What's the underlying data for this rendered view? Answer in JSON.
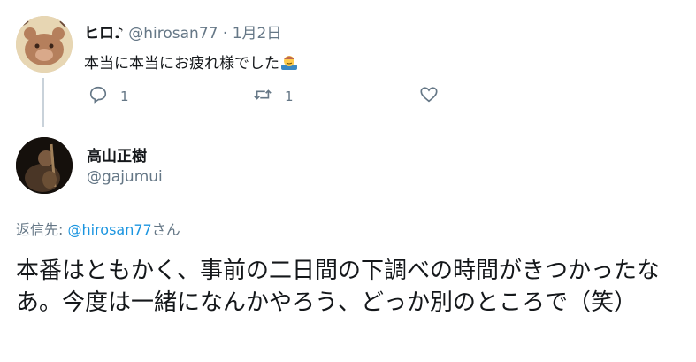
{
  "tweet1": {
    "name": "ヒロ♪",
    "handle": "@hirosan77",
    "separator": "·",
    "date": "1月2日",
    "text": "本当に本当にお疲れ様でした",
    "emoji": "bowing-person-emoji",
    "reply_count": "1",
    "retweet_count": "1",
    "icons": {
      "reply": "reply-icon",
      "retweet": "retweet-icon",
      "like": "heart-icon"
    }
  },
  "tweet2": {
    "name": "高山正樹",
    "handle": "@gajumui",
    "reply_prefix": "返信先: ",
    "reply_link": "@hirosan77",
    "reply_suffix": "さん",
    "text": "本番はともかく、事前の二日間の下調べの時間がきつかったなあ。今度は一緒になんかやろう、どっか別のところで（笑）"
  },
  "colors": {
    "text": "#14171a",
    "muted": "#657786",
    "link": "#1b95e0",
    "thread_line": "#c9d2da"
  }
}
